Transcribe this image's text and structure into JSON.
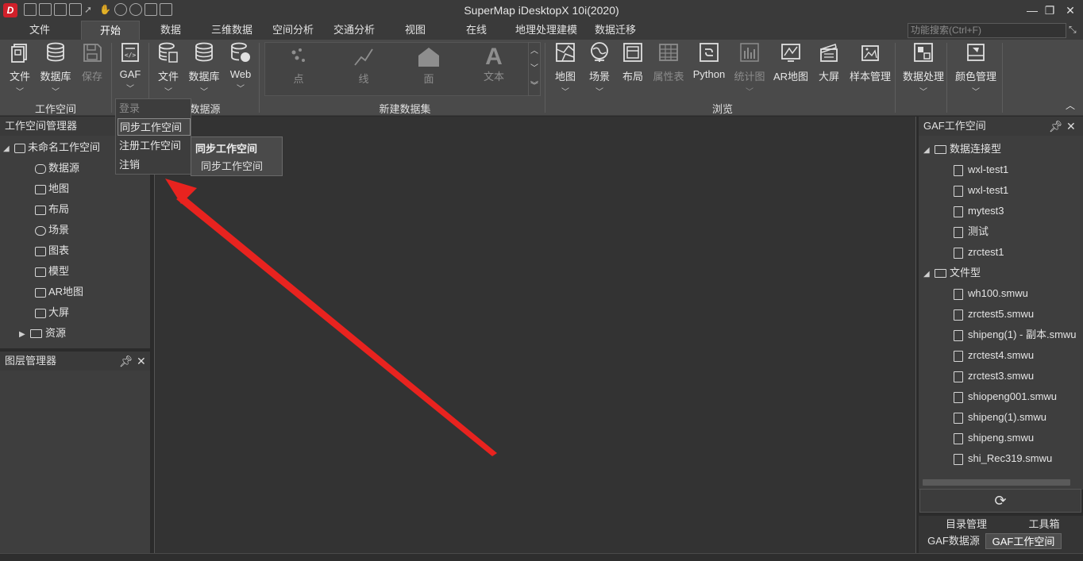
{
  "window": {
    "title": "SuperMap iDesktopX 10i(2020)",
    "minimize": "—",
    "restore": "❐",
    "close": "✕",
    "logo_letter": "D"
  },
  "tabs": [
    "文件",
    "开始",
    "数据",
    "三维数据",
    "空间分析",
    "交通分析",
    "视图",
    "在线",
    "地理处理建模",
    "数据迁移"
  ],
  "search": {
    "placeholder": "功能搜索(Ctrl+F)"
  },
  "ribbon": {
    "workspace_group": {
      "label": "工作空间",
      "file": "文件",
      "database": "数据库",
      "save": "保存"
    },
    "gaf": {
      "label": "GAF"
    },
    "datasource_group": {
      "label": "数据源",
      "file": "文件",
      "database": "数据库",
      "web": "Web"
    },
    "new_dataset_group": {
      "label": "新建数据集",
      "point": "点",
      "line": "线",
      "region": "面",
      "text": "文本"
    },
    "browse_group": {
      "label": "浏览",
      "map": "地图",
      "scene": "场景",
      "layout": "布局",
      "attribute_table": "属性表",
      "python": "Python",
      "statistics": "统计图",
      "ar_map": "AR地图",
      "big_screen": "大屏",
      "sample_manage": "样本管理"
    },
    "data_process": "数据处理",
    "color_manage": "颜色管理"
  },
  "gaf_menu": {
    "items": [
      "登录",
      "同步工作空间",
      "注册工作空间",
      "注销"
    ],
    "tooltip_title": "同步工作空间",
    "tooltip_body": "同步工作空间"
  },
  "workspace_panel": {
    "title": "工作空间管理器",
    "root": "未命名工作空间",
    "items": [
      "数据源",
      "地图",
      "布局",
      "场景",
      "图表",
      "模型",
      "AR地图",
      "大屏",
      "资源"
    ]
  },
  "layer_panel": {
    "title": "图层管理器"
  },
  "gaf_panel": {
    "title": "GAF工作空间",
    "db_group": "数据连接型",
    "db_items": [
      "wxl-test1",
      "wxl-test1",
      "mytest3",
      "测试",
      "zrctest1"
    ],
    "file_group": "文件型",
    "file_items": [
      "wh100.smwu",
      "zrctest5.smwu",
      "shipeng(1) - 副本.smwu",
      "zrctest4.smwu",
      "zrctest3.smwu",
      "shiopeng001.smwu",
      "shipeng(1).smwu",
      "shipeng.smwu",
      "shi_Rec319.smwu"
    ],
    "refresh": "⟳"
  },
  "bottom_tabs": {
    "catalog": "目录管理",
    "toolbox": "工具箱",
    "gaf_datasource": "GAF数据源",
    "gaf_workspace": "GAF工作空间"
  },
  "colors": {
    "accent_red": "#e8231f",
    "background": "#2b2b2b"
  }
}
